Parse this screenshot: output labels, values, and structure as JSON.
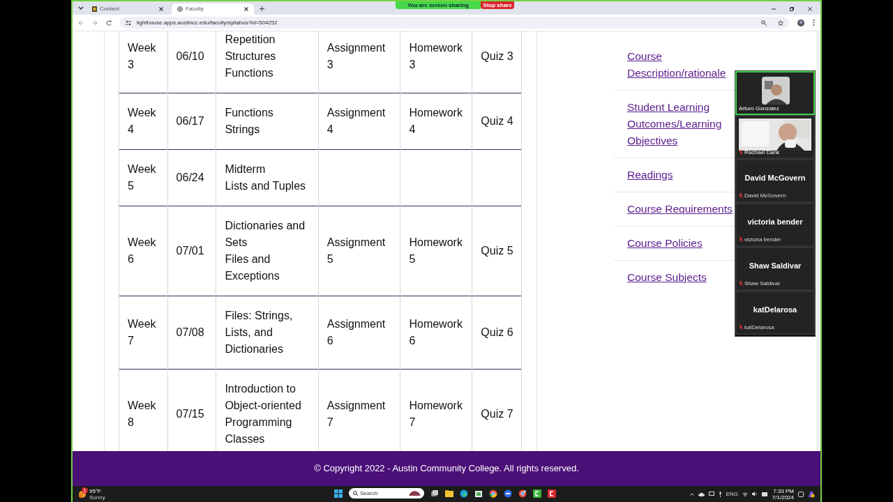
{
  "browser": {
    "tabs": [
      {
        "title": "Content",
        "selected": false
      },
      {
        "title": "Faculty",
        "selected": true
      }
    ],
    "url": "lighthouse.apps.austincc.edu/faculty/syllabus?id=504252"
  },
  "share_bar": {
    "message": "You are screen sharing",
    "stop_label": "Stop share"
  },
  "schedule": {
    "rows": [
      {
        "week": "Week 3",
        "date": "06/10",
        "topics": [
          "Repetition",
          "Structures",
          "Functions"
        ],
        "assignment": "Assignment 3",
        "homework": "Homework 3",
        "quiz": "Quiz 3"
      },
      {
        "week": "Week 4",
        "date": "06/17",
        "topics": [
          "Functions",
          "Strings"
        ],
        "assignment": "Assignment 4",
        "homework": "Homework 4",
        "quiz": "Quiz 4"
      },
      {
        "week": "Week 5",
        "date": "06/24",
        "topics": [
          "Midterm",
          "Lists and Tuples"
        ]
      },
      {
        "week": "Week 6",
        "date": "07/01",
        "topics": [
          "Dictionaries and Sets",
          "Files and Exceptions"
        ],
        "assignment": "Assignment 5",
        "homework": "Homework 5",
        "quiz": "Quiz 5"
      },
      {
        "week": "Week 7",
        "date": "07/08",
        "topics": [
          "Files: Strings, Lists, and Dictionaries"
        ],
        "assignment": "Assignment 6",
        "homework": "Homework 6",
        "quiz": "Quiz 6"
      },
      {
        "week": "Week 8",
        "date": "07/15",
        "topics": [
          "Introduction to Object-oriented Programming Classes"
        ],
        "assignment": "Assignment 7",
        "homework": "Homework 7",
        "quiz": "Quiz 7"
      }
    ]
  },
  "sidebar": {
    "links": [
      "Course Description/rationale",
      "Student Learning Outcomes/Learning Objectives",
      "Readings",
      "Course Requirements",
      "Course Policies",
      "Course Subjects"
    ]
  },
  "participants": [
    {
      "kind": "video",
      "name": "Arturo Gonzalez",
      "speaking": true,
      "muted": false
    },
    {
      "kind": "video",
      "name": "Rachael Dank",
      "speaking": false,
      "muted": true
    },
    {
      "kind": "name",
      "name": "David McGovern",
      "label": "David McGovern",
      "speaking": false,
      "muted": true
    },
    {
      "kind": "name",
      "name": "victoria bender",
      "label": "victoria bender",
      "speaking": false,
      "muted": true
    },
    {
      "kind": "name",
      "name": "Shaw Saldivar",
      "label": "Shaw Saldivar",
      "speaking": false,
      "muted": true
    },
    {
      "kind": "name",
      "name": "katDelarosa",
      "label": "katDelarosa",
      "speaking": false,
      "muted": true
    }
  ],
  "footer": {
    "text": "© Copyright 2022 - Austin Community College. All rights reserved."
  },
  "taskbar": {
    "weather_temp": "95°F",
    "weather_text": "Sunny",
    "weather_badge": "1",
    "search_placeholder": "Search",
    "language": "ENG",
    "time": "7:33 PM",
    "date": "7/1/2024"
  }
}
